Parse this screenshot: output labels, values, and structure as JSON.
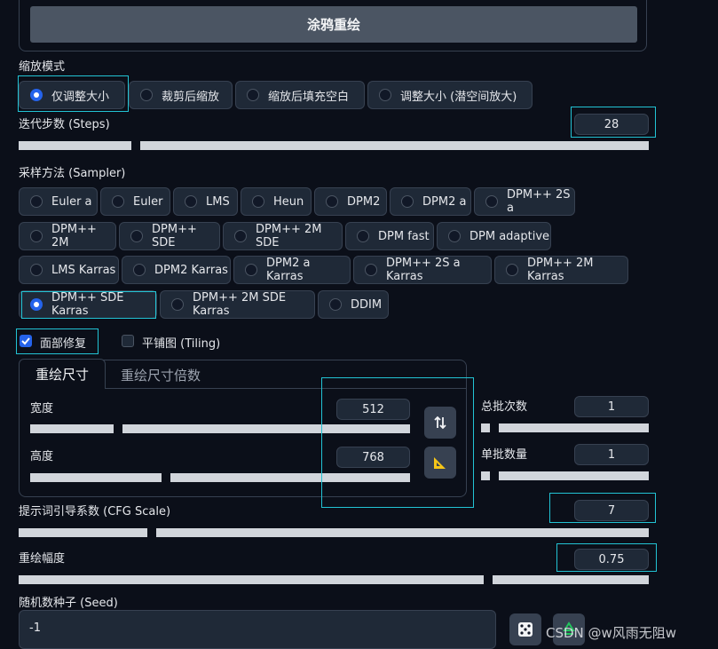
{
  "top_button": "涂鸦重绘",
  "resize_mode": {
    "label": "缩放模式",
    "options": [
      "仅调整大小",
      "裁剪后缩放",
      "缩放后填充空白",
      "调整大小 (潜空间放大)"
    ]
  },
  "steps": {
    "label": "迭代步数 (Steps)",
    "value": "28",
    "fraction": 0.2
  },
  "sampler": {
    "label": "采样方法 (Sampler)",
    "options": [
      "Euler a",
      "Euler",
      "LMS",
      "Heun",
      "DPM2",
      "DPM2 a",
      "DPM++ 2S a",
      "DPM++ 2M",
      "DPM++ SDE",
      "DPM++ 2M SDE",
      "DPM fast",
      "DPM adaptive",
      "LMS Karras",
      "DPM2 Karras",
      "DPM2 a Karras",
      "DPM++ 2S a Karras",
      "DPM++ 2M Karras",
      "DPM++ SDE Karras",
      "DPM++ 2M SDE Karras",
      "DDIM"
    ],
    "selected": "DPM++ SDE Karras"
  },
  "face_restore": {
    "label": "面部修复",
    "checked": true
  },
  "tiling": {
    "label": "平铺图 (Tiling)",
    "checked": false
  },
  "tabs": [
    "重绘尺寸",
    "重绘尺寸倍数"
  ],
  "width": {
    "label": "宽度",
    "value": "512",
    "fraction": 0.22
  },
  "height": {
    "label": "高度",
    "value": "768",
    "fraction": 0.35
  },
  "swap_icon": "swap-arrows-icon",
  "ratio_icon": "triangle-ruler-icon",
  "batch_count": {
    "label": "总批次数",
    "value": "1",
    "fraction": 0.0
  },
  "batch_size": {
    "label": "单批数量",
    "value": "1",
    "fraction": 0.0
  },
  "cfg": {
    "label": "提示词引导系数 (CFG Scale)",
    "value": "7",
    "fraction": 0.21
  },
  "denoise": {
    "label": "重绘幅度",
    "value": "0.75",
    "fraction": 0.75
  },
  "seed": {
    "label": "随机数种子 (Seed)",
    "value": "-1",
    "dice_icon": "dice-icon",
    "recycle_icon": "recycle-icon"
  },
  "watermark": "CSDN @w风雨无阻w",
  "accent": "#2563eb",
  "highlight": "#22c3d4"
}
